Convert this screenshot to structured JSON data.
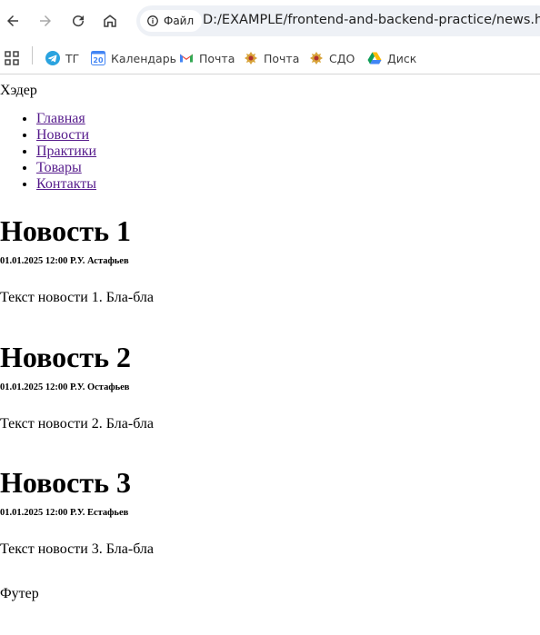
{
  "browser": {
    "chip_label": "Файл",
    "url": "D:/EXAMPLE/frontend-and-backend-practice/news.html",
    "bookmarks": [
      {
        "label": "ТГ",
        "icon": "telegram-icon"
      },
      {
        "label": "Календарь",
        "icon": "calendar-icon"
      },
      {
        "label": "Почта",
        "icon": "gmail-icon"
      },
      {
        "label": "Почта",
        "icon": "emblem-icon"
      },
      {
        "label": "СДО",
        "icon": "emblem-icon"
      },
      {
        "label": "Диск",
        "icon": "drive-icon"
      }
    ]
  },
  "page": {
    "header": "Хэдер",
    "nav": [
      "Главная",
      "Новости",
      "Практики",
      "Товары",
      "Контакты"
    ],
    "news": [
      {
        "title": "Новость 1",
        "meta": "01.01.2025 12:00 Р.У. Астафьев",
        "text": "Текст новости 1. Бла-бла"
      },
      {
        "title": "Новость 2",
        "meta": "01.01.2025 12:00 Р.У. Остафьев",
        "text": "Текст новости 2. Бла-бла"
      },
      {
        "title": "Новость 3",
        "meta": "01.01.2025 12:00 Р.У. Естафьев",
        "text": "Текст новости 3. Бла-бла"
      }
    ],
    "footer": "Футер"
  }
}
